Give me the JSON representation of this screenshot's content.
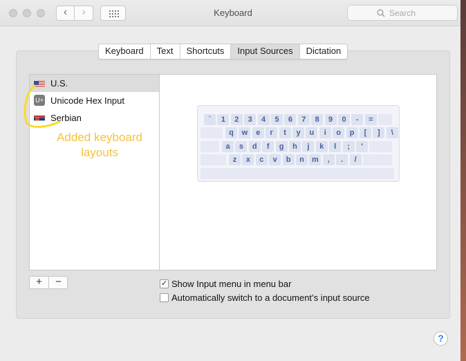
{
  "window": {
    "title": "Keyboard"
  },
  "toolbar": {
    "back_glyph": "‹",
    "forward_glyph": "›",
    "grid_icon": "grid-icon"
  },
  "search": {
    "placeholder": "Search"
  },
  "tabs": [
    {
      "label": "Keyboard",
      "active": false
    },
    {
      "label": "Text",
      "active": false
    },
    {
      "label": "Shortcuts",
      "active": false
    },
    {
      "label": "Input Sources",
      "active": true
    },
    {
      "label": "Dictation",
      "active": false
    }
  ],
  "sources": [
    {
      "label": "U.S.",
      "icon": "us-flag-icon",
      "selected": true
    },
    {
      "label": "Unicode Hex Input",
      "icon": "unicode-hex-icon",
      "icon_text": "U+",
      "selected": false
    },
    {
      "label": "Serbian",
      "icon": "serbian-flag-icon",
      "selected": false
    }
  ],
  "annotation": {
    "text": "Added keyboard layouts",
    "color": "#f6c23a"
  },
  "keyboard_rows": [
    [
      "`",
      "1",
      "2",
      "3",
      "4",
      "5",
      "6",
      "7",
      "8",
      "9",
      "0",
      "-",
      "="
    ],
    [
      "q",
      "w",
      "e",
      "r",
      "t",
      "y",
      "u",
      "i",
      "o",
      "p",
      "[",
      "]",
      "\\"
    ],
    [
      "a",
      "s",
      "d",
      "f",
      "g",
      "h",
      "j",
      "k",
      "l",
      ";",
      "'"
    ],
    [
      "z",
      "x",
      "c",
      "v",
      "b",
      "n",
      "m",
      ",",
      ".",
      "/"
    ]
  ],
  "buttons": {
    "add": "+",
    "remove": "−",
    "help": "?"
  },
  "options": {
    "show_menu": {
      "label": "Show Input menu in menu bar",
      "checked": true
    },
    "auto_switch": {
      "label": "Automatically switch to a document’s input source",
      "checked": false
    }
  }
}
